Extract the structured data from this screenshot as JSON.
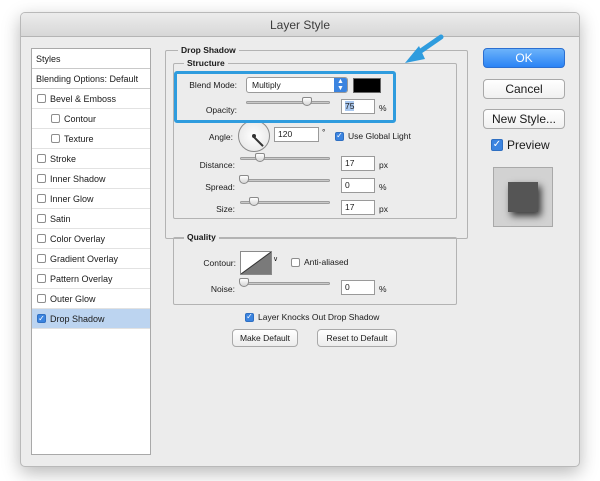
{
  "window": {
    "title": "Layer Style"
  },
  "styles_panel": {
    "header": "Styles",
    "blending_options": "Blending Options: Default",
    "items": [
      {
        "label": "Bevel & Emboss",
        "checked": false,
        "sub": false
      },
      {
        "label": "Contour",
        "checked": false,
        "sub": true
      },
      {
        "label": "Texture",
        "checked": false,
        "sub": true
      },
      {
        "label": "Stroke",
        "checked": false,
        "sub": false
      },
      {
        "label": "Inner Shadow",
        "checked": false,
        "sub": false
      },
      {
        "label": "Inner Glow",
        "checked": false,
        "sub": false
      },
      {
        "label": "Satin",
        "checked": false,
        "sub": false
      },
      {
        "label": "Color Overlay",
        "checked": false,
        "sub": false
      },
      {
        "label": "Gradient Overlay",
        "checked": false,
        "sub": false
      },
      {
        "label": "Pattern Overlay",
        "checked": false,
        "sub": false
      },
      {
        "label": "Outer Glow",
        "checked": false,
        "sub": false
      },
      {
        "label": "Drop Shadow",
        "checked": true,
        "sub": false,
        "selected": true
      }
    ]
  },
  "drop_shadow": {
    "title": "Drop Shadow",
    "structure": {
      "title": "Structure",
      "blend_mode_label": "Blend Mode:",
      "blend_mode_value": "Multiply",
      "shadow_color": "#000000",
      "opacity_label": "Opacity:",
      "opacity_value": "75",
      "opacity_unit": "%",
      "opacity_level": 0.75,
      "angle_label": "Angle:",
      "angle_value": "120",
      "angle_unit": "°",
      "use_global_light_label": "Use Global Light",
      "use_global_light_checked": true,
      "distance_label": "Distance:",
      "distance_value": "17",
      "distance_unit": "px",
      "spread_label": "Spread:",
      "spread_value": "0",
      "spread_unit": "%",
      "size_label": "Size:",
      "size_value": "17",
      "size_unit": "px"
    },
    "quality": {
      "title": "Quality",
      "contour_label": "Contour:",
      "anti_aliased_label": "Anti-aliased",
      "anti_aliased_checked": false,
      "noise_label": "Noise:",
      "noise_value": "0",
      "noise_unit": "%"
    },
    "knocks_out_label": "Layer Knocks Out Drop Shadow",
    "knocks_out_checked": true,
    "make_default_label": "Make Default",
    "reset_default_label": "Reset to Default"
  },
  "buttons": {
    "ok": "OK",
    "cancel": "Cancel",
    "new_style": "New Style...",
    "preview_label": "Preview",
    "preview_checked": true
  },
  "colors": {
    "accent": "#2f9cde",
    "ok_button": "#2a83f5"
  }
}
